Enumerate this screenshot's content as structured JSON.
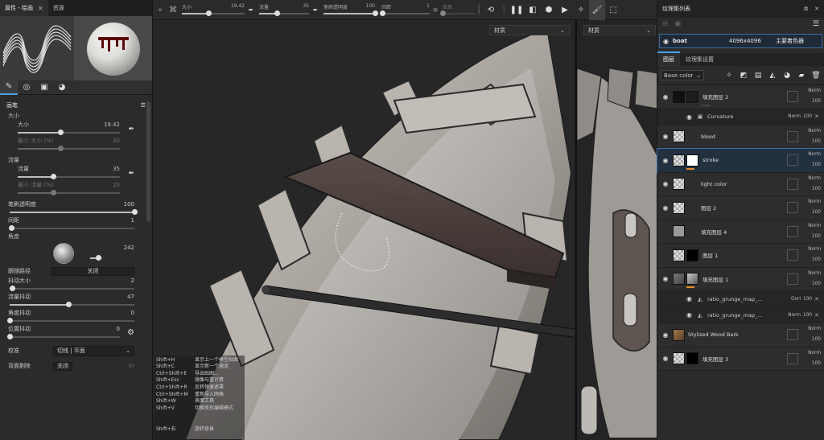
{
  "left_panel": {
    "tabs": [
      {
        "label": "属性 - 绘画",
        "close": "✕"
      },
      {
        "label": "资源"
      }
    ],
    "section_brush": "画笔",
    "size": {
      "label": "大小",
      "sub_label": "大小",
      "value": "19.42",
      "min_label": "最小 大小 (%)",
      "min_value": "30",
      "fraction": 0.42
    },
    "flow": {
      "label": "流量",
      "sub_label": "流量",
      "value": "35",
      "min_label": "最小 流量 (%)",
      "min_value": "20",
      "fraction": 0.35
    },
    "opacity": {
      "label": "笔刷透明度",
      "value": "100",
      "fraction": 1.0
    },
    "spacing": {
      "label": "间距",
      "value": "1",
      "fraction": 0.01
    },
    "angle": {
      "label": "角度",
      "value": "242",
      "fraction": 0.67
    },
    "follow_path": {
      "label": "跟随路径",
      "value": "关闭"
    },
    "jitter_size": {
      "label": "抖动大小",
      "value": "2",
      "fraction": 0.02
    },
    "flow_jitter": {
      "label": "流量抖动",
      "value": "47",
      "fraction": 0.47
    },
    "angle_jitter": {
      "label": "角度抖动",
      "value": "0",
      "fraction": 0.0
    },
    "position_jitter": {
      "label": "位置抖动",
      "value": "0",
      "fraction": 0.0
    },
    "alignment": {
      "label": "校准",
      "value": "切线 | 平面"
    },
    "backface": {
      "label": "背面剔除",
      "value": "关闭",
      "extra_value": "90"
    }
  },
  "topbar": {
    "size": {
      "label": "大小",
      "value": "19.42",
      "fraction": 0.42
    },
    "flow": {
      "label": "流量",
      "value": "35",
      "fraction": 0.35
    },
    "opacity": {
      "label": "笔刷透明度",
      "value": "100",
      "fraction": 1.0
    },
    "spacing": {
      "label": "间距",
      "value": "1",
      "fraction": 0.01
    },
    "distance": {
      "label": "距离",
      "fraction": 0.0
    }
  },
  "viewport": {
    "material_select_3d": "材质",
    "material_select_2d": "材质",
    "shortcuts": [
      {
        "key": "Shift+H",
        "desc": "显示上一个模型贴图"
      },
      {
        "key": "Shift+C",
        "desc": "显示新一个通道"
      },
      {
        "key": "Ctrl+Shift+E",
        "desc": "导出贴图..."
      },
      {
        "key": "Shift+Esc",
        "desc": "镜像与重计算"
      },
      {
        "key": "Ctrl+Shift+R",
        "desc": "反转快速遮罩"
      },
      {
        "key": "Ctrl+Shift+M",
        "desc": "重新导入网格"
      },
      {
        "key": "Shift+W",
        "desc": "表面工具"
      },
      {
        "key": "Shift+V",
        "desc": "切换变形编辑模式"
      },
      {
        "key": "Shift+右",
        "desc": "旋转背景"
      }
    ]
  },
  "texture_set_list": {
    "title": "纹理集列表",
    "set": {
      "name": "boat",
      "size": "4096x4096",
      "shader": "主要着色器"
    }
  },
  "layers_panel": {
    "tabs": [
      "图层",
      "纹理集设置"
    ],
    "channel": "Base color",
    "layers": [
      {
        "name": "填充图层 2",
        "blend": "Norm",
        "opacity": "100",
        "thumb": "dark",
        "mask": "dark-mask",
        "visible": true
      },
      {
        "effect": true,
        "name": "Curvature",
        "blend": "Norm",
        "opacity": "100"
      },
      {
        "name": "blood",
        "blend": "Norm",
        "opacity": "100",
        "thumb": "checker",
        "visible": true
      },
      {
        "name": "stroke",
        "blend": "Norm",
        "opacity": "100",
        "thumb": "checker",
        "mask": "white",
        "visible": true,
        "selected": true
      },
      {
        "name": "light color",
        "blend": "Norm",
        "opacity": "100",
        "thumb": "checker",
        "visible": true
      },
      {
        "name": "图层 2",
        "blend": "Norm",
        "opacity": "100",
        "thumb": "checker",
        "visible": true
      },
      {
        "name": "填充图层 4",
        "blend": "Norm",
        "opacity": "100",
        "thumb": "grey",
        "visible": false
      },
      {
        "name": "图层 1",
        "blend": "Norm",
        "opacity": "100",
        "thumb": "checker",
        "mask": "black",
        "visible": false
      },
      {
        "name": "填充图层 1",
        "blend": "Norm",
        "opacity": "100",
        "thumb": "grunge",
        "mask": "grunge",
        "visible": true
      },
      {
        "effect": true,
        "name": "ratio_grunge_map_...",
        "blend": "Ovrl",
        "opacity": "100"
      },
      {
        "effect": true,
        "name": "ratio_grunge_map_...",
        "blend": "Norm",
        "opacity": "100"
      },
      {
        "name": "Stylized Wood Bark",
        "blend": "Norm",
        "opacity": "100",
        "thumb": "wood",
        "visible": true
      },
      {
        "name": "填充图层 3",
        "blend": "Norm",
        "opacity": "100",
        "thumb": "checker",
        "mask": "black",
        "visible": true
      }
    ]
  },
  "colors": {
    "accent": "#4aa3e8",
    "orange": "#e98c2b",
    "panel": "#2b2b2b"
  }
}
